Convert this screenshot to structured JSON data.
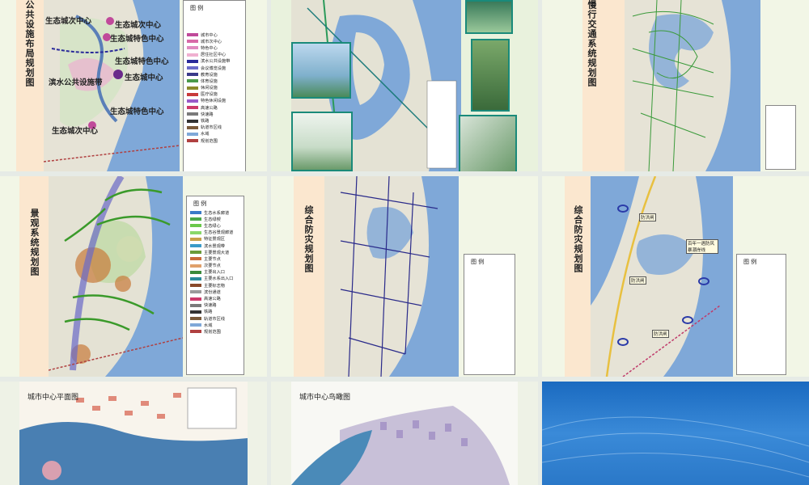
{
  "panels": {
    "p1": {
      "title": "公共设施布局规划图",
      "labels": [
        "生态城次中心",
        "生态城次中心",
        "生态城特色中心",
        "生态城特色中心",
        "滨水公共设施带",
        "生态城中心",
        "生态城特色中心",
        "生态城次中心"
      ],
      "legend_title": "图 例",
      "legend": [
        "城市中心",
        "城市次中心",
        "特色中心",
        "居住社区中心",
        "滨水公共设施带",
        "会议博览设施",
        "教育设施",
        "体育设施",
        "休闲设施",
        "医疗设施",
        "特色休闲设施",
        "高速公路",
        "快速路",
        "铁路",
        "轨道市区线",
        "水域",
        "规划范围"
      ]
    },
    "p4": {
      "title": "景观系统规划图",
      "legend_title": "图 例",
      "legend": [
        "生态水系廊道",
        "生态绿楔",
        "生态绿心",
        "生态谷景观廊道",
        "特征景观区",
        "滨水景观带",
        "主要景观大道",
        "主要节点",
        "次要节点",
        "主要出入口",
        "主要水系出入口",
        "主要标志物",
        "滨份通道",
        "高速公路",
        "快速路",
        "铁路",
        "轨道市区线",
        "水域",
        "规划范围"
      ]
    },
    "p5": {
      "title": "综合防灾规划图",
      "legend_title": "图 例"
    },
    "p6": {
      "title": "综合防灾规划图",
      "legend_title": "图 例",
      "labels": [
        "防洪闸",
        "百年一遇防风暴潮岸线",
        "防洪闸",
        "防洪闸"
      ]
    },
    "p3": {
      "title": "慢行交通系统规划图"
    },
    "p7": {
      "title": "城市中心平面图"
    },
    "p8": {
      "title": "城市中心鸟瞰图"
    }
  },
  "colors": {
    "slide_bg": "#f2f6e6",
    "sidebar": "#fbe7cf",
    "water": "#7fa8d8",
    "green": "#3fae3a",
    "accent_blue": "#2a7ac8"
  }
}
